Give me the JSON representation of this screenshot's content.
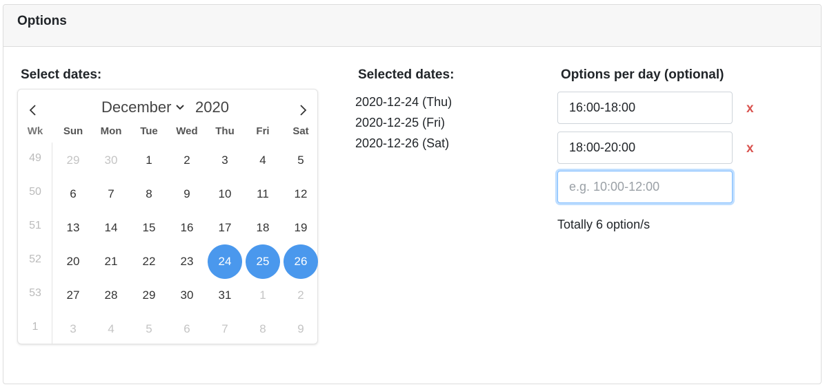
{
  "card": {
    "title": "Options"
  },
  "select_dates": {
    "heading": "Select dates:"
  },
  "calendar": {
    "month": "December",
    "year": "2020",
    "week_label": "Wk",
    "weekdays": [
      "Sun",
      "Mon",
      "Tue",
      "Wed",
      "Thu",
      "Fri",
      "Sat"
    ],
    "rows": [
      {
        "week": "49",
        "days": [
          "29",
          "30",
          "1",
          "2",
          "3",
          "4",
          "5"
        ]
      },
      {
        "week": "50",
        "days": [
          "6",
          "7",
          "8",
          "9",
          "10",
          "11",
          "12"
        ]
      },
      {
        "week": "51",
        "days": [
          "13",
          "14",
          "15",
          "16",
          "17",
          "18",
          "19"
        ]
      },
      {
        "week": "52",
        "days": [
          "20",
          "21",
          "22",
          "23",
          "24",
          "25",
          "26"
        ]
      },
      {
        "week": "53",
        "days": [
          "27",
          "28",
          "29",
          "30",
          "31",
          "1",
          "2"
        ]
      },
      {
        "week": "1",
        "days": [
          "3",
          "4",
          "5",
          "6",
          "7",
          "8",
          "9"
        ]
      }
    ],
    "muted": [
      [
        0,
        0
      ],
      [
        0,
        1
      ],
      [
        4,
        5
      ],
      [
        4,
        6
      ],
      [
        5,
        0
      ],
      [
        5,
        1
      ],
      [
        5,
        2
      ],
      [
        5,
        3
      ],
      [
        5,
        4
      ],
      [
        5,
        5
      ],
      [
        5,
        6
      ]
    ],
    "selected": [
      [
        3,
        4
      ],
      [
        3,
        5
      ],
      [
        3,
        6
      ]
    ],
    "selected_color": "#4a98ed"
  },
  "selected_dates": {
    "heading": "Selected dates:",
    "items": [
      "2020-12-24 (Thu)",
      "2020-12-25 (Fri)",
      "2020-12-26 (Sat)"
    ]
  },
  "options": {
    "heading": "Options per day (optional)",
    "inputs": [
      {
        "value": "16:00-18:00",
        "remove": "x"
      },
      {
        "value": "18:00-20:00",
        "remove": "x"
      }
    ],
    "new_placeholder": "e.g. 10:00-12:00",
    "total": "Totally 6 option/s",
    "remove_color": "#d9534f"
  }
}
